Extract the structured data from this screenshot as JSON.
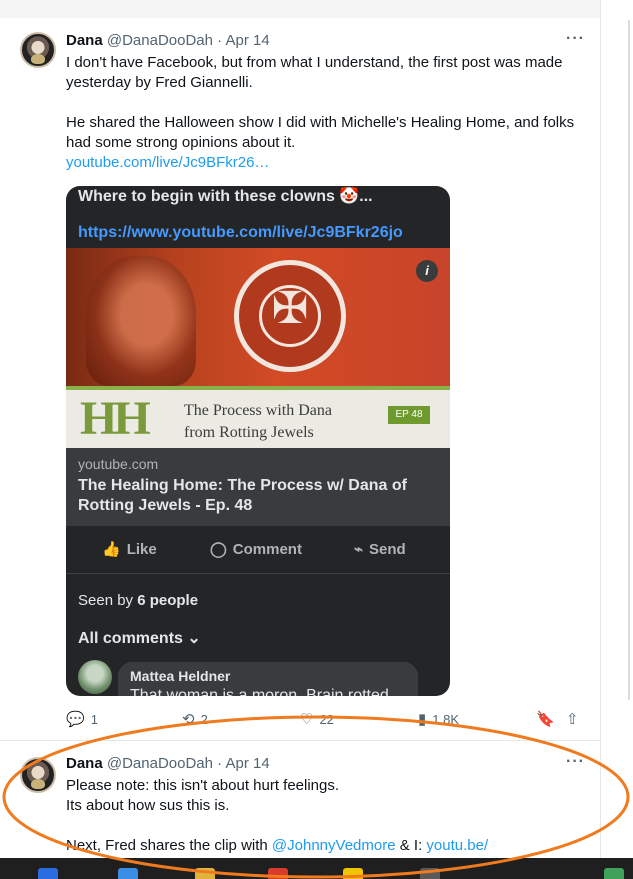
{
  "post1": {
    "name": "Dana",
    "handle": "@DanaDooDah",
    "date": "· Apr 14",
    "more": "···",
    "p1": "I don't have Facebook, but from what I understand, the first post was made yesterday by Fred Giannelli.",
    "p2": "He shared the Halloween show I did with Michelle's Healing Home, and folks had some strong opinions about it.",
    "link": "youtube.com/live/Jc9BFkr26…",
    "embed": {
      "line1": "Where to begin with these clowns 🤡...",
      "line2": "https://www.youtube.com/live/Jc9BFkr26jo",
      "info": "i",
      "hh": "HH",
      "process_line1": "The Process with Dana",
      "process_line2": "from Rotting Jewels",
      "ep": "EP 48",
      "domain": "youtube.com",
      "title": "The Healing Home: The Process w/ Dana of Rotting Jewels - Ep. 48",
      "like": "Like",
      "comment": "Comment",
      "send": "Send",
      "seen_prefix": "Seen by ",
      "seen_count": "6 people",
      "all_comments": "All comments ⌄",
      "commenter": "Mattea Heldner",
      "comment_text": "That woman is a moron. Brain rotted before the jewels did."
    },
    "stats": {
      "replies": "1",
      "reposts": "2",
      "likes": "22",
      "views": "1.8K"
    }
  },
  "post2": {
    "name": "Dana",
    "handle": "@DanaDooDah",
    "date": "· Apr 14",
    "more": "···",
    "l1": "Please note: this isn't about hurt feelings.",
    "l2": "Its about how sus this is.",
    "l3_prefix": "Next, Fred shares the clip with ",
    "mention": "@JohnnyVedmore",
    "l3_mid": " & I: ",
    "link": "youtu.be/"
  },
  "icons": {
    "reply": "reply-icon",
    "repost": "repost-icon",
    "like": "heart-icon",
    "views": "views-icon",
    "bookmark": "bookmark-icon",
    "share": "share-icon"
  },
  "colors": {
    "accent_link": "#1d9bf0",
    "annotation": "#f07a1e"
  }
}
